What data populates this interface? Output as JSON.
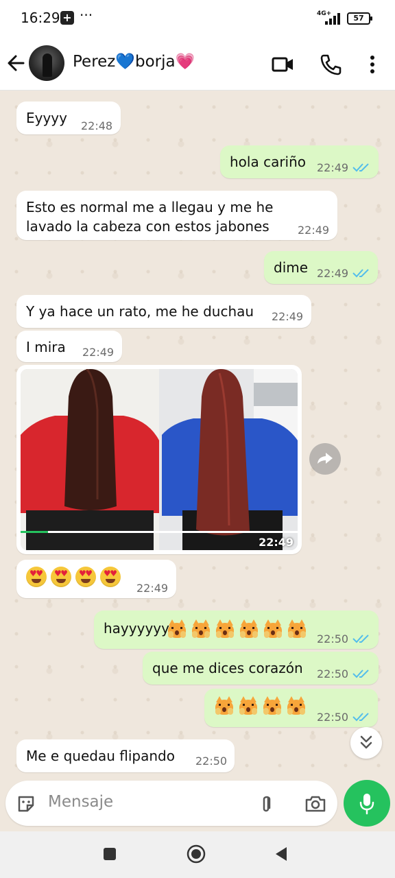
{
  "status_bar": {
    "time": "16:29",
    "network": "4G+",
    "battery": "57",
    "more": "···",
    "notification_icon": "app-notification-icon"
  },
  "header": {
    "contact_name": "Perez💙borja💗",
    "icons": [
      "back-arrow-icon",
      "video-call-icon",
      "phone-icon",
      "more-vert-icon"
    ]
  },
  "messages": [
    {
      "dir": "in",
      "text": "Eyyyy",
      "time": "22:48"
    },
    {
      "dir": "out",
      "text": "hola cariño",
      "time": "22:49",
      "read": true
    },
    {
      "dir": "in",
      "text": "Esto es normal me a llegau y me he\nlavado la cabeza con estos jabones",
      "time": "22:49"
    },
    {
      "dir": "out",
      "text": "dime",
      "time": "22:49",
      "read": true
    },
    {
      "dir": "in",
      "text": "Y ya hace un rato, me he duchau",
      "time": "22:49"
    },
    {
      "dir": "in",
      "text": "I mira",
      "time": "22:49"
    },
    {
      "dir": "in",
      "type": "image",
      "time": "22:49",
      "image": "before-after-hair-comparison"
    },
    {
      "dir": "in",
      "type": "emoji",
      "emoji": "heart-eyes-face",
      "count": 4,
      "time": "22:49"
    },
    {
      "dir": "out",
      "text": "hayyyyyy",
      "emoji": "weary-cat",
      "count": 6,
      "time": "22:50",
      "read": true
    },
    {
      "dir": "out",
      "text": "que me dices corazón",
      "time": "22:50",
      "read": true
    },
    {
      "dir": "out",
      "type": "emoji",
      "emoji": "weary-cat",
      "count": 4,
      "time": "22:50",
      "read": true
    },
    {
      "dir": "in",
      "text": "Me e quedau flipando",
      "time": "22:50"
    }
  ],
  "composer": {
    "placeholder": "Mensaje",
    "icons": [
      "sticker-icon",
      "attach-icon",
      "camera-icon",
      "mic-icon"
    ]
  },
  "colors": {
    "incoming": "#ffffff",
    "outgoing": "#dcf8c6",
    "accent": "#25c25e",
    "ticks": "#53bdeb"
  }
}
